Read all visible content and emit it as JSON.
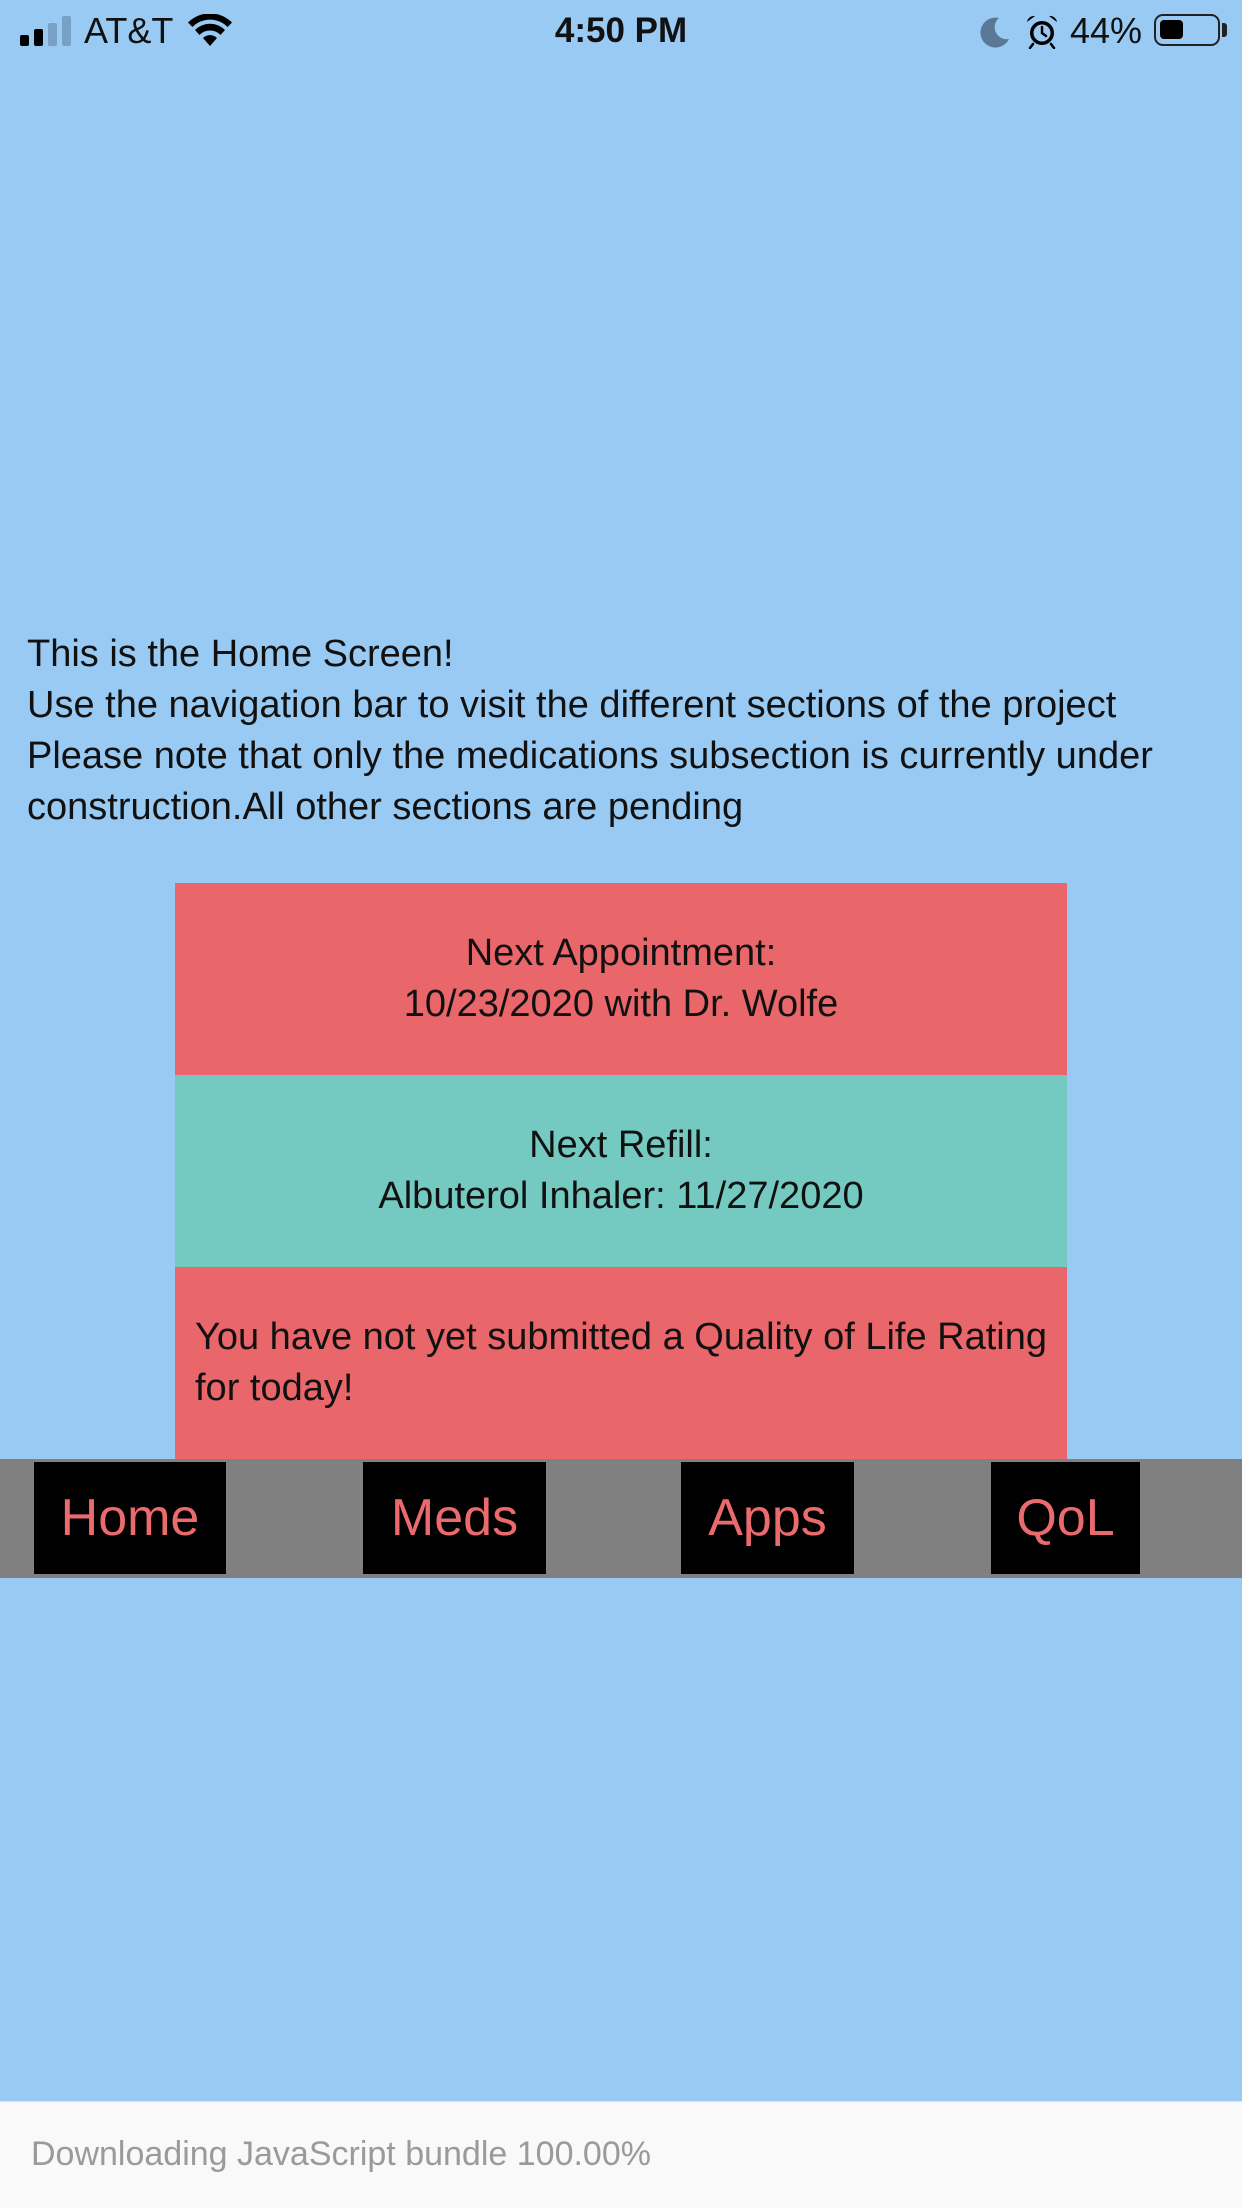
{
  "status_bar": {
    "carrier": "AT&T",
    "time": "4:50 PM",
    "battery_percent": "44%",
    "battery_level": 0.44,
    "signal_bars_active": 2,
    "signal_bars_total": 4,
    "icons": [
      "signal-icon",
      "wifi-icon",
      "moon-icon",
      "alarm-icon",
      "battery-icon"
    ]
  },
  "intro": {
    "line1": "This is the Home Screen!",
    "line2": "Use the navigation bar to visit the different sections of the project",
    "line3": "Please note that only the medications subsection is currently under construction.All other sections are pending"
  },
  "cards": {
    "appointment": {
      "label": "Next Appointment:",
      "value": "10/23/2020 with Dr. Wolfe",
      "color": "#e9666a"
    },
    "refill": {
      "label": "Next Refill:",
      "value": "Albuterol Inhaler: 11/27/2020",
      "color": "#74cac1"
    },
    "qol": {
      "message": "You have not yet submitted a Quality of Life Rating for today!",
      "color": "#e9666a"
    }
  },
  "nav": {
    "home": "Home",
    "meds": "Meds",
    "apps": "Apps",
    "qol": "QoL",
    "text_color": "#eb6a6e"
  },
  "loading": {
    "text": "Downloading JavaScript bundle 100.00%"
  },
  "colors": {
    "background": "#99caf3",
    "nav_bar": "#808080"
  }
}
